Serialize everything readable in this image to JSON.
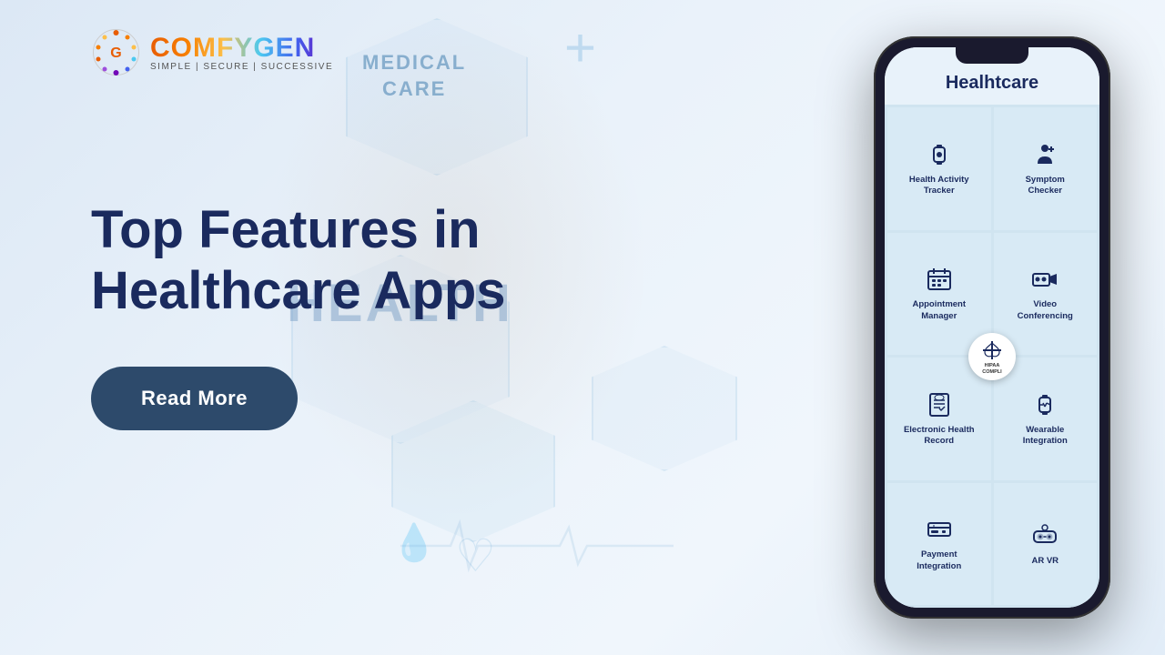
{
  "logo": {
    "brand": "COMFYGEN",
    "tagline": "SIMPLE | SECURE | SUCCESSIVE"
  },
  "headline": {
    "line1": "Top Features in",
    "line2": "Healthcare Apps"
  },
  "read_more_btn": "Read More",
  "background_texts": {
    "medical_care": "MEDICAL\nCARE",
    "health": "HEALTH",
    "cross": "+"
  },
  "phone": {
    "title": "Healhtcare",
    "cells": [
      {
        "icon": "⌚",
        "label": "Health Activity\nTracker",
        "id": "health-activity-tracker"
      },
      {
        "icon": "🩺",
        "label": "Symptom\nChecker",
        "id": "symptom-checker"
      },
      {
        "icon": "📅",
        "label": "Appointment\nManager",
        "id": "appointment-manager"
      },
      {
        "icon": "💻",
        "label": "Video\nConferencing",
        "id": "video-conferencing"
      },
      {
        "icon": "📋",
        "label": "Electronic Health\nRecord",
        "id": "electronic-health-record"
      },
      {
        "icon": "⌚",
        "label": "Wearable\nIntegration",
        "id": "wearable-integration"
      },
      {
        "icon": "💳",
        "label": "Payment\nIntegration",
        "id": "payment-integration"
      },
      {
        "icon": "🥽",
        "label": "AR VR",
        "id": "ar-vr"
      }
    ],
    "hipaa_label": "HIPAA\nCOMPLI..."
  },
  "colors": {
    "bg_start": "#dce8f5",
    "bg_end": "#eaf2fa",
    "headline_color": "#1a2a5e",
    "btn_bg": "#2d4a6b",
    "btn_text": "#ffffff",
    "phone_bg": "#1a1a2e",
    "phone_screen": "#f0f6fb",
    "cell_bg": "#d8eaf5"
  }
}
